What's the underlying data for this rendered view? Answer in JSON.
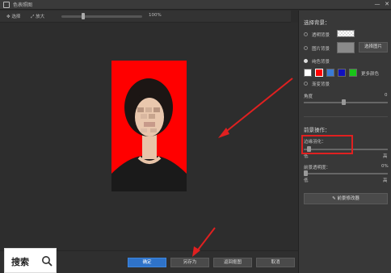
{
  "window": {
    "title": "色表照图",
    "min_label": "—",
    "close_label": "✕"
  },
  "toolbar": {
    "tool1": "选择",
    "tool2": "放大",
    "zoom_value": "100%"
  },
  "right_panel": {
    "section_title": "选择背景：",
    "opt_transparent": "透明背景",
    "opt_image": "图片背景",
    "choose_image_btn": "选择图片",
    "opt_solid": "纯色背景",
    "swatches": [
      "#ffffff",
      "#ff0000",
      "#3a7bd5",
      "#1010c0",
      "#19c519"
    ],
    "more_colors": "更多颜色",
    "opt_gradient": "渐变背景",
    "angle_label": "角度",
    "angle_value": "0",
    "fg_title": "前景操作：",
    "edge_label": "边缘羽化：",
    "edge_low": "低",
    "edge_high": "高",
    "opacity_label": "前景透明度：",
    "opacity_value": "0%",
    "opacity_low": "低",
    "opacity_high": "高",
    "fg_select_btn": "前景修改器"
  },
  "bottombar": {
    "ok": "确定",
    "save_as": "另存为",
    "back": "返回抠图",
    "cancel": "取消"
  },
  "watermark": {
    "text": "搜索"
  }
}
